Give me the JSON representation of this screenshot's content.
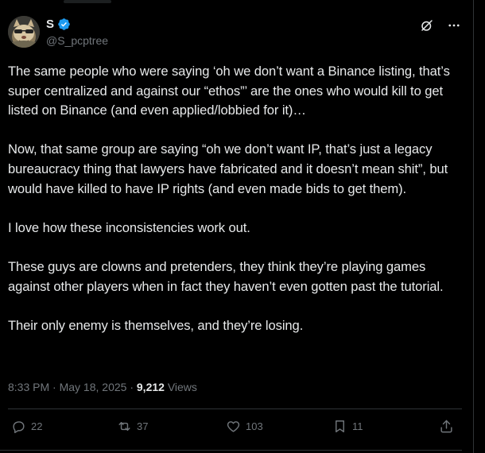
{
  "author": {
    "display_name": "S",
    "handle": "@S_pcptree",
    "avatar_icon": "avatar-cat",
    "verified_color": "#1d9bf0"
  },
  "header_actions": {
    "grok_icon": "grok-icon",
    "more_icon": "more-icon"
  },
  "tweet": {
    "paragraphs": [
      "The same people who were saying ‘oh we don’t want a Binance listing, that’s super centralized and against our “ethos”’ are the ones who would kill to get listed on Binance (and even applied/lobbied for it)…",
      "Now, that same group are saying “oh we don’t want IP, that’s just a legacy bureaucracy thing that lawyers have fabricated and it doesn’t mean shit”, but would have killed to have IP rights (and even made bids to get them).",
      "I love how these inconsistencies work out.",
      "These guys are clowns and pretenders, they think they’re playing games against other players when in fact they haven’t even gotten past the tutorial.",
      "Their only enemy is themselves, and they’re losing."
    ]
  },
  "meta": {
    "time": "8:33 PM",
    "separator": " · ",
    "date": "May 18, 2025",
    "views_count": "9,212",
    "views_label": " Views"
  },
  "actions": {
    "replies": "22",
    "reposts": "37",
    "likes": "103",
    "bookmarks": "11"
  },
  "colors": {
    "background": "#000000",
    "text": "#e7e9ea",
    "secondary": "#71767b",
    "border": "#2f3336",
    "accent": "#1d9bf0"
  }
}
